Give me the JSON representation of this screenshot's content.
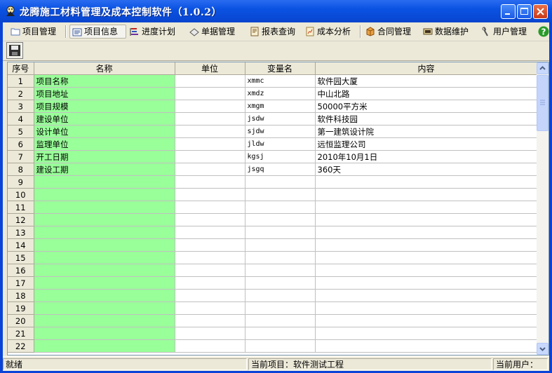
{
  "window": {
    "title": "龙腾施工材料管理及成本控制软件（1.0.2）"
  },
  "menu": {
    "items": [
      {
        "label": "项目管理",
        "icon": "folder-icon"
      },
      {
        "label": "项目信息",
        "icon": "document-icon"
      },
      {
        "label": "进度计划",
        "icon": "gantt-icon"
      },
      {
        "label": "单据管理",
        "icon": "eraser-icon"
      },
      {
        "label": "报表查询",
        "icon": "report-icon"
      },
      {
        "label": "成本分析",
        "icon": "analysis-icon"
      },
      {
        "label": "合同管理",
        "icon": "box-icon"
      },
      {
        "label": "数据维护",
        "icon": "database-icon"
      },
      {
        "label": "用户管理",
        "icon": "wrench-icon"
      }
    ],
    "help_icon": "help-icon"
  },
  "toolbar": {
    "save_icon": "save-icon"
  },
  "grid": {
    "headers": [
      "序号",
      "名称",
      "单位",
      "变量名",
      "内容"
    ],
    "rows": [
      {
        "no": "1",
        "name": "项目名称",
        "unit": "",
        "var": "xmmc",
        "content": "软件园大厦"
      },
      {
        "no": "2",
        "name": "项目地址",
        "unit": "",
        "var": "xmdz",
        "content": "中山北路"
      },
      {
        "no": "3",
        "name": "项目规模",
        "unit": "",
        "var": "xmgm",
        "content": "50000平方米"
      },
      {
        "no": "4",
        "name": "建设单位",
        "unit": "",
        "var": "jsdw",
        "content": "软件科技园"
      },
      {
        "no": "5",
        "name": "设计单位",
        "unit": "",
        "var": "sjdw",
        "content": "第一建筑设计院"
      },
      {
        "no": "6",
        "name": "监理单位",
        "unit": "",
        "var": "jldw",
        "content": "远恒监理公司"
      },
      {
        "no": "7",
        "name": "开工日期",
        "unit": "",
        "var": "kgsj",
        "content": "2010年10月1日"
      },
      {
        "no": "8",
        "name": "建设工期",
        "unit": "",
        "var": "jsgq",
        "content": "360天"
      },
      {
        "no": "9",
        "name": "",
        "unit": "",
        "var": "",
        "content": ""
      },
      {
        "no": "10",
        "name": "",
        "unit": "",
        "var": "",
        "content": ""
      },
      {
        "no": "11",
        "name": "",
        "unit": "",
        "var": "",
        "content": ""
      },
      {
        "no": "12",
        "name": "",
        "unit": "",
        "var": "",
        "content": ""
      },
      {
        "no": "13",
        "name": "",
        "unit": "",
        "var": "",
        "content": ""
      },
      {
        "no": "14",
        "name": "",
        "unit": "",
        "var": "",
        "content": ""
      },
      {
        "no": "15",
        "name": "",
        "unit": "",
        "var": "",
        "content": ""
      },
      {
        "no": "16",
        "name": "",
        "unit": "",
        "var": "",
        "content": ""
      },
      {
        "no": "17",
        "name": "",
        "unit": "",
        "var": "",
        "content": ""
      },
      {
        "no": "18",
        "name": "",
        "unit": "",
        "var": "",
        "content": ""
      },
      {
        "no": "19",
        "name": "",
        "unit": "",
        "var": "",
        "content": ""
      },
      {
        "no": "20",
        "name": "",
        "unit": "",
        "var": "",
        "content": ""
      },
      {
        "no": "21",
        "name": "",
        "unit": "",
        "var": "",
        "content": ""
      },
      {
        "no": "22",
        "name": "",
        "unit": "",
        "var": "",
        "content": ""
      }
    ]
  },
  "status": {
    "ready": "就绪",
    "current_project": "当前项目：软件测试工程",
    "current_user": "当前用户："
  },
  "colors": {
    "name_column": "#99ff99",
    "title_bar": "#0a52e2"
  }
}
